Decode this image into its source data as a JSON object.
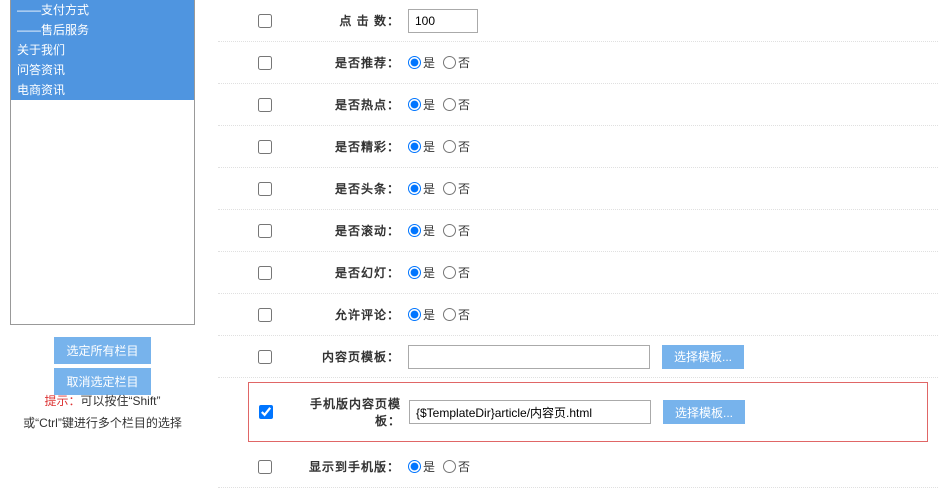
{
  "sidebar": {
    "items": [
      {
        "label": "——支付方式"
      },
      {
        "label": "——售后服务"
      },
      {
        "label": "关于我们"
      },
      {
        "label": "问答资讯"
      },
      {
        "label": "电商资讯"
      }
    ],
    "buttons": {
      "select_all": "选定所有栏目",
      "deselect": "取消选定栏目"
    },
    "tip_label": "提示：",
    "tip_line1": "可以按住“Shift”",
    "tip_line2": "或“Ctrl”键进行多个栏目的选择"
  },
  "yes": "是",
  "no": "否",
  "rows": {
    "hits": {
      "label": "点 击 数：",
      "value": "100"
    },
    "recommend": {
      "label": "是否推荐："
    },
    "hot": {
      "label": "是否热点："
    },
    "wonderful": {
      "label": "是否精彩："
    },
    "headline": {
      "label": "是否头条："
    },
    "scroll": {
      "label": "是否滚动："
    },
    "slide": {
      "label": "是否幻灯："
    },
    "comment": {
      "label": "允许评论："
    },
    "tpl": {
      "label": "内容页模板：",
      "value": "",
      "btn": "选择模板..."
    },
    "m_tpl": {
      "label": "手机版内容页模板：",
      "value": "{$TemplateDir}article/内容页.html",
      "btn": "选择模板..."
    },
    "show_m": {
      "label": "显示到手机版："
    }
  }
}
